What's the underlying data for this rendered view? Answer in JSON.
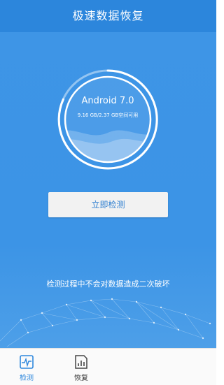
{
  "app": {
    "title": "极速数据恢复"
  },
  "device": {
    "os_name": "Android 7.0",
    "storage_text": "9.16 GB/2.37 GB空间可用"
  },
  "actions": {
    "detect_label": "立即检测"
  },
  "notice": "检测过程中不会对数据造成二次破坏",
  "tabs": [
    {
      "label": "检测",
      "icon": "pulse-monitor-icon",
      "active": true
    },
    {
      "label": "恢复",
      "icon": "bar-chart-document-icon",
      "active": false
    }
  ],
  "colors": {
    "primary": "#3c94e6",
    "titlebar": "#2c86dc",
    "tab_active": "#2d87dd",
    "button_bg": "#f2f2f2",
    "button_text": "#2f7fd0"
  }
}
